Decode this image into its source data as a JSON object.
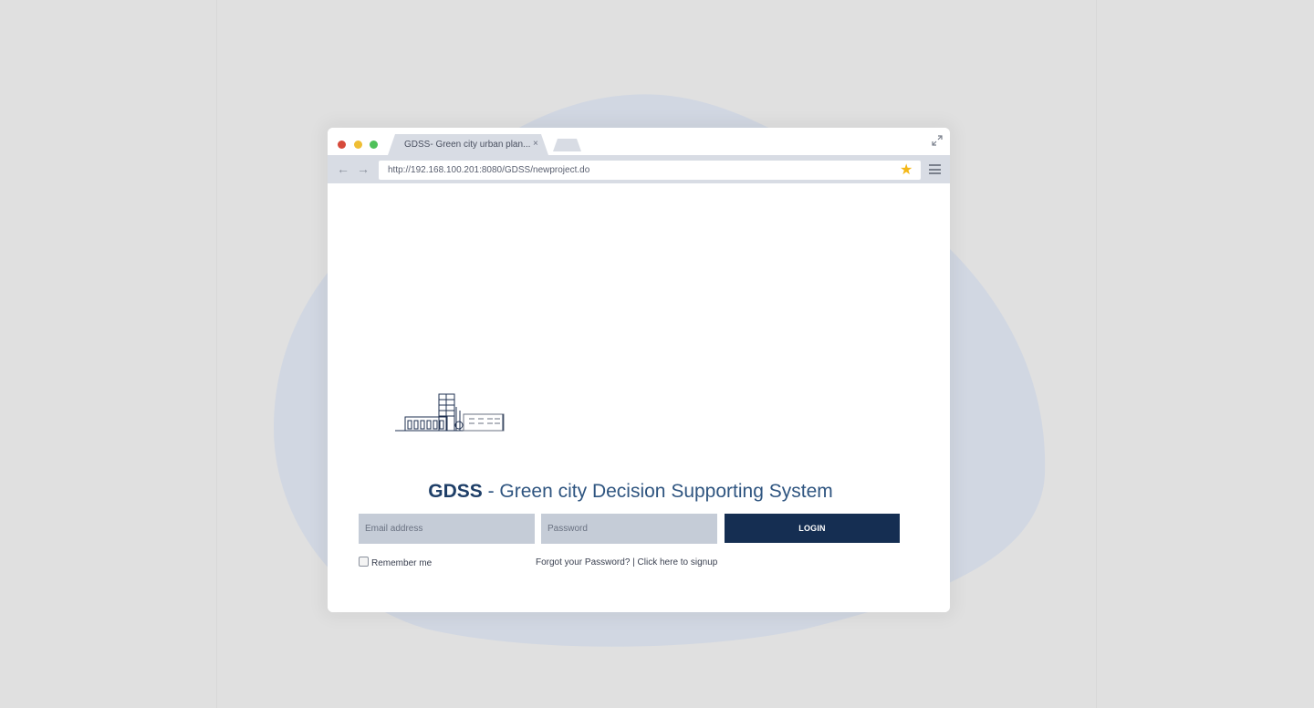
{
  "colors": {
    "background": "#e0e0e0",
    "blob": "#d1d7e2",
    "tab": "#d8dce4",
    "title": "#2f5580",
    "login_button": "#152e52",
    "input": "#c5ccd7",
    "star": "#f4b818"
  },
  "browser": {
    "tab_title": "GDSS- Green city urban plan...",
    "tab_close_icon": "close-icon",
    "url": "http://192.168.100.201:8080/GDSS/newproject.do",
    "icons": [
      "back-arrow-icon",
      "forward-arrow-icon",
      "star-icon",
      "menu-icon",
      "expand-icon"
    ]
  },
  "page": {
    "title_acronym": "GDSS",
    "title_rest": " - Green city Decision Supporting System",
    "email_placeholder": "Email address",
    "password_placeholder": "Password",
    "login_label": "LOGIN",
    "remember_label": "Remember me",
    "forgot_link": "Forgot your Password?",
    "separator": " | ",
    "signup_link": "Click here to signup"
  }
}
